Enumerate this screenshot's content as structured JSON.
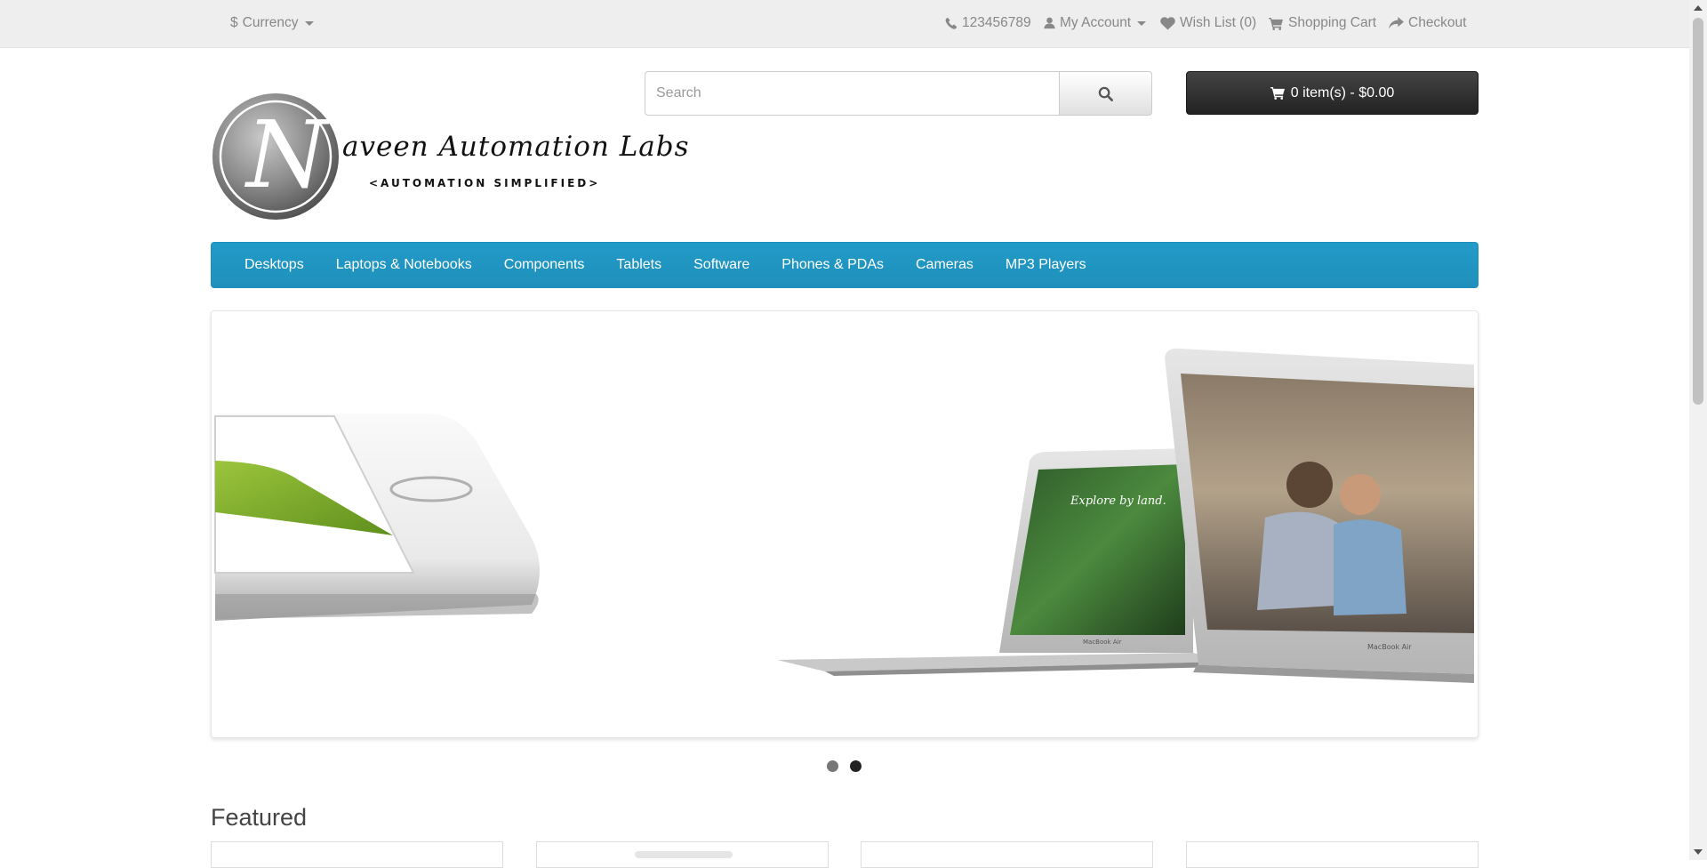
{
  "topbar": {
    "currency_label": "Currency",
    "phone": "123456789",
    "my_account": "My Account",
    "wishlist": "Wish List (0)",
    "shopping_cart": "Shopping Cart",
    "checkout": "Checkout"
  },
  "logo": {
    "letter": "N",
    "text": "aveen Automation Labs",
    "tagline": "<AUTOMATION SIMPLIFIED>"
  },
  "search": {
    "placeholder": "Search"
  },
  "cart": {
    "label": "0 item(s) - $0.00"
  },
  "menu": {
    "items": [
      "Desktops",
      "Laptops & Notebooks",
      "Components",
      "Tablets",
      "Software",
      "Phones & PDAs",
      "Cameras",
      "MP3 Players"
    ]
  },
  "slideshow": {
    "slides": 2,
    "active_slide": 2
  },
  "featured": {
    "title": "Featured"
  },
  "colors": {
    "menu_blue": "#229ac8",
    "cart_dark": "#222222",
    "topbar_gray": "#eeeeee"
  }
}
